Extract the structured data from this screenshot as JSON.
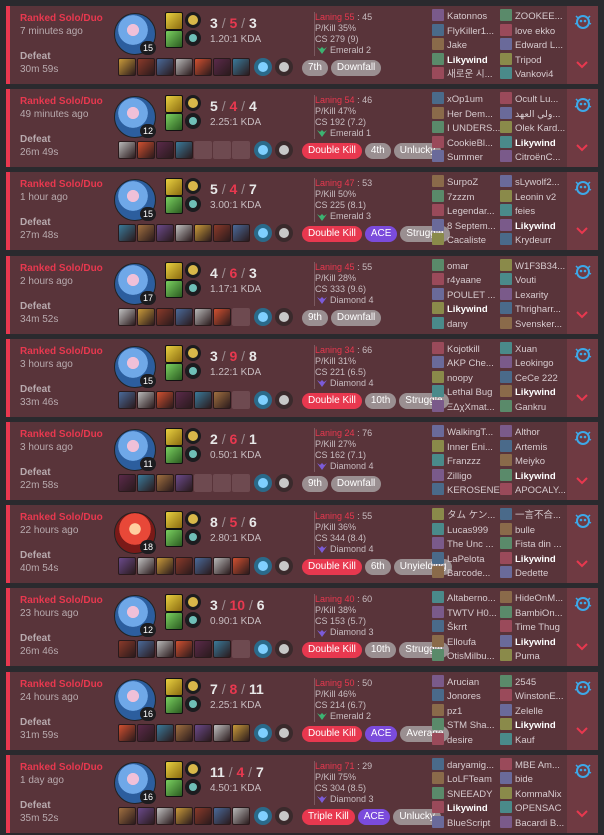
{
  "matches": [
    {
      "queue": "Ranked Solo/Duo",
      "ago": "7 minutes ago",
      "result": "Defeat",
      "duration": "30m 59s",
      "level": "15",
      "kills": "3",
      "deaths": "5",
      "assists": "3",
      "kda": "1.20:1 KDA",
      "champ": "jinx",
      "empty_items": 0,
      "tags": [
        {
          "text": "7th",
          "style": "gray"
        },
        {
          "text": "Downfall",
          "style": "gray"
        }
      ],
      "laning": "Laning 55",
      "laning_opp": ": 45",
      "pkill": "P/Kill 35%",
      "cs": "CS 279 (9)",
      "rank": "Emerald 2",
      "rank_color": "#3cb371",
      "team_a": [
        "Katonnos",
        "FlyKiller1...",
        "Jake",
        "Likywind",
        "새로운 시..."
      ],
      "team_b": [
        "ZOOKEE...",
        "love ekko",
        "Edward L...",
        "Tripod",
        "Vankovi4"
      ],
      "me": "a3"
    },
    {
      "queue": "Ranked Solo/Duo",
      "ago": "49 minutes ago",
      "result": "Defeat",
      "duration": "26m 49s",
      "level": "12",
      "kills": "5",
      "deaths": "4",
      "assists": "4",
      "kda": "2.25:1 KDA",
      "champ": "jinx",
      "empty_items": 3,
      "tags": [
        {
          "text": "Double Kill",
          "style": "red"
        },
        {
          "text": "4th",
          "style": "gray"
        },
        {
          "text": "Unlucky",
          "style": "gray"
        }
      ],
      "laning": "Laning 54",
      "laning_opp": ": 46",
      "pkill": "P/Kill 47%",
      "cs": "CS 192 (7.2)",
      "rank": "Emerald 1",
      "rank_color": "#3cb371",
      "team_a": [
        "xOp1um",
        "Her Dem...",
        "I UNDERS...",
        "CookieBl...",
        "Summer"
      ],
      "team_b": [
        "Ocult Lu...",
        "ولي العهد...",
        "Olek Kard...",
        "Likywind",
        "CitroënC..."
      ],
      "me": "b3"
    },
    {
      "queue": "Ranked Solo/Duo",
      "ago": "1 hour ago",
      "result": "Defeat",
      "duration": "27m 48s",
      "level": "15",
      "kills": "5",
      "deaths": "4",
      "assists": "7",
      "kda": "3.00:1 KDA",
      "champ": "jinx",
      "empty_items": 0,
      "tags": [
        {
          "text": "Double Kill",
          "style": "red"
        },
        {
          "text": "ACE",
          "style": "purple"
        },
        {
          "text": "Struggle",
          "style": "gray"
        }
      ],
      "laning": "Laning 47",
      "laning_opp": ": 53",
      "pkill": "P/Kill 50%",
      "cs": "CS 225 (8.1)",
      "rank": "Emerald 3",
      "rank_color": "#3cb371",
      "team_a": [
        "SurpoZ",
        "7zzzm",
        "Legendar...",
        "8 Septem...",
        "Cacaliste"
      ],
      "team_b": [
        "sLywolf2...",
        "Leonin v2",
        "feies",
        "Likywind",
        "Krydeurr"
      ],
      "me": "b3"
    },
    {
      "queue": "Ranked Solo/Duo",
      "ago": "2 hours ago",
      "result": "Defeat",
      "duration": "34m 52s",
      "level": "17",
      "kills": "4",
      "deaths": "6",
      "assists": "3",
      "kda": "1.17:1 KDA",
      "champ": "jinx",
      "empty_items": 1,
      "tags": [
        {
          "text": "9th",
          "style": "gray"
        },
        {
          "text": "Downfall",
          "style": "gray"
        }
      ],
      "laning": "Laning 45",
      "laning_opp": ": 55",
      "pkill": "P/Kill 28%",
      "cs": "CS 333 (9.6)",
      "rank": "Diamond 4",
      "rank_color": "#7b5bd8",
      "team_a": [
        "omar",
        "r4yaane",
        "POULET ...",
        "Likywind",
        "dany"
      ],
      "team_b": [
        "W1F3B34...",
        "Vouti",
        "Lexarity",
        "Thrigharr...",
        "Svensker..."
      ],
      "me": "a3"
    },
    {
      "queue": "Ranked Solo/Duo",
      "ago": "3 hours ago",
      "result": "Defeat",
      "duration": "33m 46s",
      "level": "15",
      "kills": "3",
      "deaths": "9",
      "assists": "8",
      "kda": "1.22:1 KDA",
      "champ": "jinx",
      "empty_items": 1,
      "tags": [
        {
          "text": "Double Kill",
          "style": "red"
        },
        {
          "text": "10th",
          "style": "gray"
        },
        {
          "text": "Struggle",
          "style": "gray"
        }
      ],
      "laning": "Laning 34",
      "laning_opp": ": 66",
      "pkill": "P/Kill 31%",
      "cs": "CS 221 (6.5)",
      "rank": "Diamond 4",
      "rank_color": "#7b5bd8",
      "team_a": [
        "Kojotkill",
        "AKP Che...",
        "noopy",
        "Lethal Bug",
        "ΞΔχXmat..."
      ],
      "team_b": [
        "Xuan",
        "Leokingo",
        "CeCe 222",
        "Likywind",
        "Gankru"
      ],
      "me": "b3"
    },
    {
      "queue": "Ranked Solo/Duo",
      "ago": "3 hours ago",
      "result": "Defeat",
      "duration": "22m 58s",
      "level": "11",
      "kills": "2",
      "deaths": "6",
      "assists": "1",
      "kda": "0.50:1 KDA",
      "champ": "jinx",
      "empty_items": 3,
      "tags": [
        {
          "text": "9th",
          "style": "gray"
        },
        {
          "text": "Downfall",
          "style": "gray"
        }
      ],
      "laning": "Laning 24",
      "laning_opp": ": 76",
      "pkill": "P/Kill 27%",
      "cs": "CS 162 (7.1)",
      "rank": "Diamond 4",
      "rank_color": "#7b5bd8",
      "team_a": [
        "WalkingT...",
        "Inner Eni...",
        "Franzzz",
        "Zilligo",
        "KEROSENE"
      ],
      "team_b": [
        "Althor",
        "Artemis",
        "Meiyko",
        "Likywind",
        "APOCALY..."
      ],
      "me": "b3"
    },
    {
      "queue": "Ranked Solo/Duo",
      "ago": "22 hours ago",
      "result": "Defeat",
      "duration": "40m 54s",
      "level": "18",
      "kills": "8",
      "deaths": "5",
      "assists": "6",
      "kda": "2.80:1 KDA",
      "champ": "alt",
      "empty_items": 0,
      "tags": [
        {
          "text": "Double Kill",
          "style": "red"
        },
        {
          "text": "6th",
          "style": "gray"
        },
        {
          "text": "Unyielding",
          "style": "gray"
        }
      ],
      "laning": "Laning 45",
      "laning_opp": ": 55",
      "pkill": "P/Kill 36%",
      "cs": "CS 344 (8.4)",
      "rank": "Diamond 4",
      "rank_color": "#7b5bd8",
      "team_a": [
        "タム ケン...",
        "Lucas999",
        "The Unc ...",
        "LaPelota",
        "Barcode..."
      ],
      "team_b": [
        "一言不合...",
        "bulle",
        "Fista din ...",
        "Likywind",
        "Dedette"
      ],
      "me": "b3"
    },
    {
      "queue": "Ranked Solo/Duo",
      "ago": "23 hours ago",
      "result": "Defeat",
      "duration": "26m 46s",
      "level": "12",
      "kills": "3",
      "deaths": "10",
      "assists": "6",
      "kda": "0.90:1 KDA",
      "champ": "jinx",
      "empty_items": 1,
      "tags": [
        {
          "text": "Double Kill",
          "style": "red"
        },
        {
          "text": "10th",
          "style": "gray"
        },
        {
          "text": "Struggle",
          "style": "gray"
        }
      ],
      "laning": "Laning 40",
      "laning_opp": ": 60",
      "pkill": "P/Kill 38%",
      "cs": "CS 153 (5.7)",
      "rank": "Diamond 3",
      "rank_color": "#7b5bd8",
      "team_a": [
        "Altaberno...",
        "TWTV H0...",
        "Škrrt",
        "Elloufa",
        "OtisMilbu..."
      ],
      "team_b": [
        "HideOnM...",
        "BambiOn...",
        "Time Thug",
        "Likywind",
        "Puma"
      ],
      "me": "b3"
    },
    {
      "queue": "Ranked Solo/Duo",
      "ago": "24 hours ago",
      "result": "Defeat",
      "duration": "31m 59s",
      "level": "16",
      "kills": "7",
      "deaths": "8",
      "assists": "11",
      "kda": "2.25:1 KDA",
      "champ": "jinx",
      "empty_items": 0,
      "tags": [
        {
          "text": "Double Kill",
          "style": "red"
        },
        {
          "text": "ACE",
          "style": "purple"
        },
        {
          "text": "Average",
          "style": "gray"
        }
      ],
      "laning": "Laning 50",
      "laning_opp": ": 50",
      "pkill": "P/Kill 46%",
      "cs": "CS 214 (6.7)",
      "rank": "Emerald 2",
      "rank_color": "#3cb371",
      "team_a": [
        "Arucian",
        "Jonores",
        "pz1",
        "STM Sha...",
        "desire"
      ],
      "team_b": [
        "2545",
        "WinstonE...",
        "Zelelle",
        "Likywind",
        "Kauf"
      ],
      "me": "b3"
    },
    {
      "queue": "Ranked Solo/Duo",
      "ago": "1 day ago",
      "result": "Defeat",
      "duration": "35m 52s",
      "level": "16",
      "kills": "11",
      "deaths": "4",
      "assists": "7",
      "kda": "4.50:1 KDA",
      "champ": "jinx",
      "empty_items": 0,
      "tags": [
        {
          "text": "Triple Kill",
          "style": "red"
        },
        {
          "text": "ACE",
          "style": "purple"
        },
        {
          "text": "Unlucky",
          "style": "gray"
        }
      ],
      "laning": "Laning 71",
      "laning_opp": ": 29",
      "pkill": "P/Kill 75%",
      "cs": "CS 304 (8.5)",
      "rank": "Diamond 3",
      "rank_color": "#7b5bd8",
      "team_a": [
        "daryamig...",
        "LoLFTeam",
        "SNEEADY",
        "Likywind",
        "BlueScript"
      ],
      "team_b": [
        "MBE Am...",
        "bide",
        "KommaNix",
        "OPENSAC",
        "Bacardi B..."
      ],
      "me": "a3"
    }
  ],
  "icons": {
    "ai_icon": "ai-assistant-icon",
    "expand_icon": "chevron-down-icon"
  }
}
